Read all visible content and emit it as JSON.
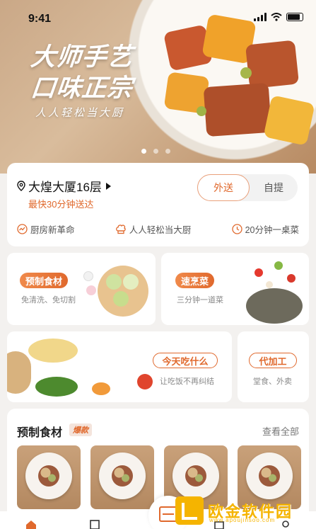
{
  "status_bar": {
    "time": "9:41"
  },
  "banner": {
    "title_line1": "大师手艺",
    "title_line2": "口味正宗",
    "subtitle": "人人轻松当大厨",
    "carousel_total": 3,
    "carousel_active": 1
  },
  "location": {
    "address": "大煌大厦16层",
    "eta": "最快30分钟送达",
    "mode_options": [
      "外送",
      "自提"
    ],
    "mode_selected": "外送"
  },
  "features": [
    {
      "icon": "trend-icon",
      "label": "厨房新革命"
    },
    {
      "icon": "chef-hat-icon",
      "label": "人人轻松当大厨"
    },
    {
      "icon": "clock-icon",
      "label": "20分钟一桌菜"
    }
  ],
  "promos": {
    "prepared": {
      "tag": "预制食材",
      "desc": "免清洗、免切割"
    },
    "quick": {
      "tag": "速烹菜",
      "desc": "三分钟一道菜"
    },
    "today": {
      "tag": "今天吃什么",
      "desc": "让吃饭不再纠结"
    },
    "processing": {
      "tag": "代加工",
      "desc": "堂食、外卖"
    }
  },
  "section": {
    "title": "预制食材",
    "badge": "爆款",
    "see_all": "查看全部"
  },
  "watermark": {
    "name": "欧金软件园",
    "url": "www.apoujinsoo.com"
  },
  "colors": {
    "accent": "#e0692d",
    "background": "#f3f1ef"
  }
}
